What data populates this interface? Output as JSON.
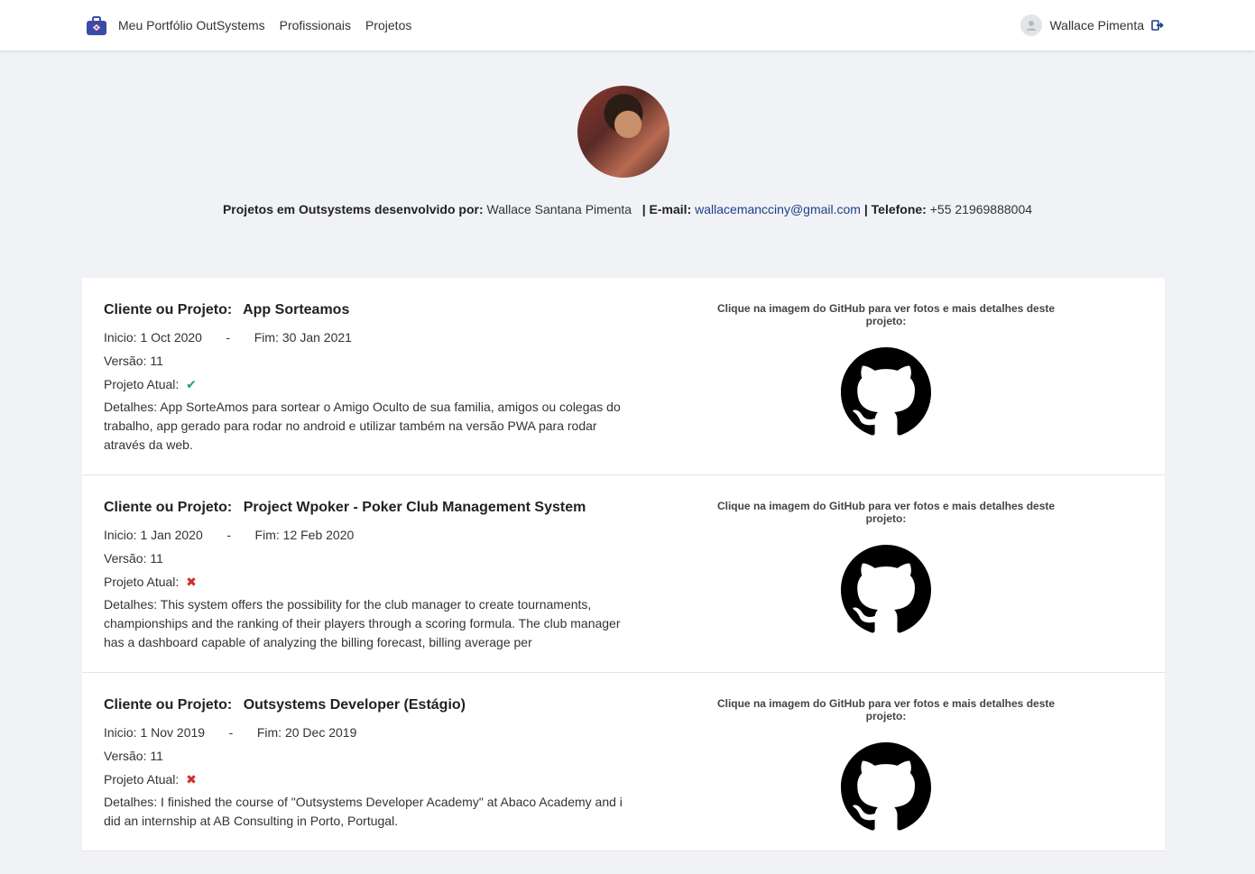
{
  "header": {
    "brand_icon": "portfolio-briefcase-icon",
    "brand_color": "#3b4ba8",
    "nav": [
      {
        "label": "Meu Portfólio OutSystems"
      },
      {
        "label": "Profissionais"
      },
      {
        "label": "Projetos"
      }
    ],
    "user_name": "Wallace Pimenta",
    "user_icon": "user-avatar-icon",
    "logout_icon": "logout-icon"
  },
  "profile": {
    "photo_icon": "profile-photo",
    "developed_by_label": "Projetos em Outsystems desenvolvido por:",
    "developer_name": "Wallace Santana Pimenta",
    "email_label": "| E-mail:",
    "email": "wallacemancciny@gmail.com",
    "phone_label": "| Telefone:",
    "phone": "+55 21969888004"
  },
  "projects": [
    {
      "title_label": "Cliente ou Projeto:",
      "title": "App Sorteamos",
      "start_label": "Inicio:",
      "start": "1 Oct 2020",
      "dash": "-",
      "end_label": "Fim:",
      "end": "30 Jan 2021",
      "version_label": "Versão:",
      "version": "11",
      "current_label": "Projeto Atual:",
      "current_symbol": "✔",
      "details": "Detalhes: App SorteAmos para sortear o Amigo Oculto de sua familia, amigos ou colegas do trabalho, app gerado para rodar no android e utilizar também na versão PWA para rodar através da web.",
      "github_caption": "Clique na imagem do GitHub para ver fotos e mais detalhes deste projeto:"
    },
    {
      "title_label": "Cliente ou Projeto:",
      "title": "Project Wpoker - Poker Club Management System",
      "start_label": "Inicio:",
      "start": "1 Jan 2020",
      "dash": "-",
      "end_label": "Fim:",
      "end": "12 Feb 2020",
      "version_label": "Versão:",
      "version": "11",
      "current_label": "Projeto Atual:",
      "current_symbol": "✖",
      "details": "Detalhes: This system offers the possibility for the club manager to create tournaments, championships and the ranking of their players through a scoring formula.  The club manager has a dashboard capable of analyzing the billing forecast, billing average per",
      "github_caption": "Clique na imagem do GitHub para ver fotos e mais detalhes deste projeto:"
    },
    {
      "title_label": "Cliente ou Projeto:",
      "title": "Outsystems Developer (Estágio)",
      "start_label": "Inicio:",
      "start": "1 Nov 2019",
      "dash": "-",
      "end_label": "Fim:",
      "end": "20 Dec 2019",
      "version_label": "Versão:",
      "version": "11",
      "current_label": "Projeto Atual:",
      "current_symbol": "✖",
      "details": "Detalhes: I finished the course of \"Outsystems Developer Academy\" at Abaco Academy and i did an internship at AB Consulting in Porto, Portugal.",
      "github_caption": "Clique na imagem do GitHub para ver fotos e mais detalhes deste projeto:"
    }
  ],
  "colors": {
    "check": "#1fa35b",
    "cross": "#d12b2b",
    "link": "#1c3e8a"
  },
  "github_icon": "github-logo-icon"
}
